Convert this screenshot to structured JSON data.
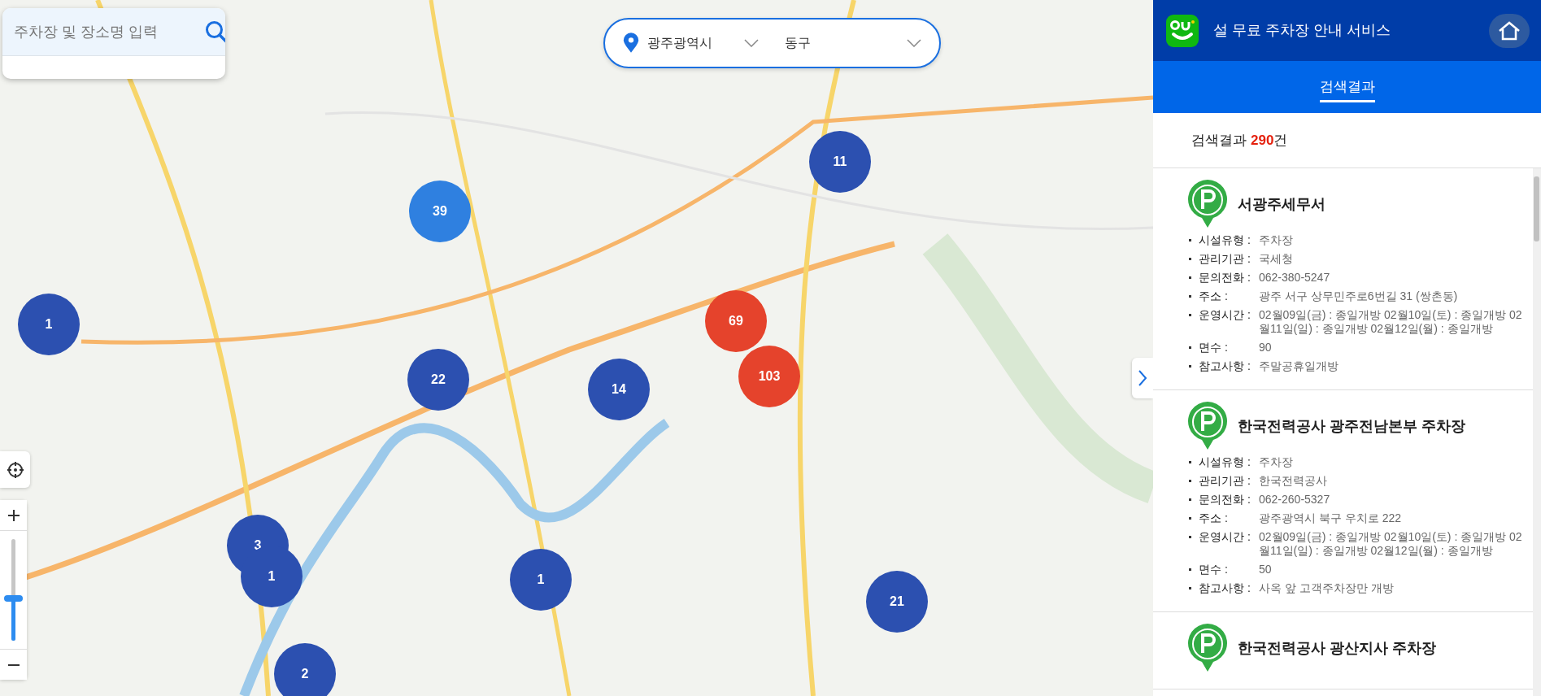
{
  "search": {
    "placeholder": "주차장 및 장소명 입력"
  },
  "region": {
    "city": "광주광역시",
    "district": "동구"
  },
  "clusters": [
    {
      "count": "39",
      "color": "#2f80e0"
    },
    {
      "count": "11",
      "color": "#2c50b0"
    },
    {
      "count": "1",
      "color": "#2c50b0"
    },
    {
      "count": "69",
      "color": "#e5432c"
    },
    {
      "count": "103",
      "color": "#e5432c"
    },
    {
      "count": "22",
      "color": "#2c50b0"
    },
    {
      "count": "14",
      "color": "#2c50b0"
    },
    {
      "count": "3",
      "color": "#2c50b0"
    },
    {
      "count": "1",
      "color": "#2c50b0"
    },
    {
      "count": "1",
      "color": "#2c50b0"
    },
    {
      "count": "21",
      "color": "#2c50b0"
    },
    {
      "count": "2",
      "color": "#2c50b0"
    }
  ],
  "zoom": {
    "level": 0.42
  },
  "panel": {
    "title": "설 무료 주차장 안내 서비스",
    "tabs": [
      {
        "label": "검색결과",
        "selected": true
      }
    ],
    "result_label": "검색결과",
    "result_count": "290",
    "result_suffix": "건",
    "results": [
      {
        "name": "서광주세무서",
        "fields": [
          {
            "label": "시설유형 :",
            "value": "주차장"
          },
          {
            "label": "관리기관 :",
            "value": "국세청"
          },
          {
            "label": "문의전화 :",
            "value": "062-380-5247"
          },
          {
            "label": "주소 :",
            "value": "광주 서구 상무민주로6번길 31 (쌍촌동)"
          },
          {
            "label": "운영시간 :",
            "value": "02월09일(금) : 종일개방 02월10일(토) : 종일개방 02월11일(일) : 종일개방 02월12일(월) : 종일개방"
          },
          {
            "label": "면수 :",
            "value": "90"
          },
          {
            "label": "참고사항 :",
            "value": "주말공휴일개방"
          }
        ]
      },
      {
        "name": "한국전력공사 광주전남본부 주차장",
        "fields": [
          {
            "label": "시설유형 :",
            "value": "주차장"
          },
          {
            "label": "관리기관 :",
            "value": "한국전력공사"
          },
          {
            "label": "문의전화 :",
            "value": "062-260-5327"
          },
          {
            "label": "주소 :",
            "value": "광주광역시 북구 우치로 222"
          },
          {
            "label": "운영시간 :",
            "value": "02월09일(금) : 종일개방 02월10일(토) : 종일개방 02월11일(일) : 종일개방 02월12일(월) : 종일개방"
          },
          {
            "label": "면수 :",
            "value": "50"
          },
          {
            "label": "참고사항 :",
            "value": "사옥 앞 고객주차장만 개방"
          }
        ]
      },
      {
        "name": "한국전력공사 광산지사 주차장"
      }
    ]
  }
}
